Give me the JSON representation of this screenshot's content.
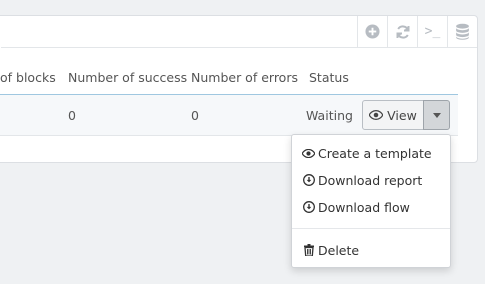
{
  "table": {
    "headers": [
      "of blocks",
      "Number of success",
      "Number of errors",
      "Status"
    ],
    "row": {
      "success": "0",
      "errors": "0",
      "status": "Waiting"
    }
  },
  "toolbar": {
    "icons": [
      "add-icon",
      "refresh-icon",
      "terminal-icon",
      "database-icon"
    ],
    "terminal_glyph": ">_"
  },
  "actions": {
    "view_label": "View"
  },
  "dropdown": {
    "items": [
      "Create a template",
      "Download report",
      "Download flow",
      "Delete"
    ]
  },
  "colors": {
    "background": "#eff1f3",
    "panel": "#ffffff",
    "header_underline": "#9fc7e0",
    "icon_gray": "#b7bcc2"
  }
}
